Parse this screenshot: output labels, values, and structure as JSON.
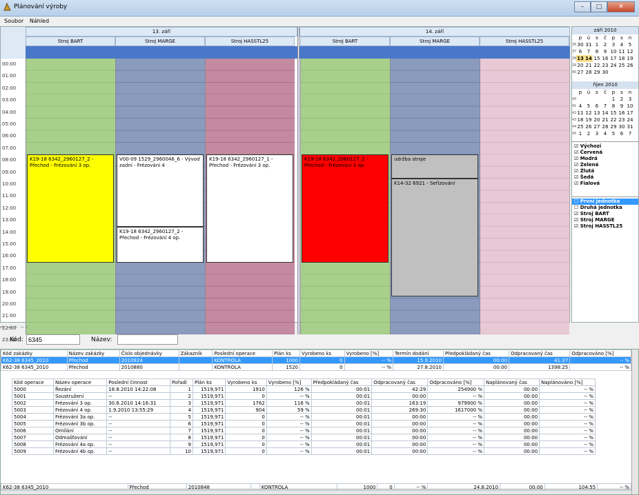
{
  "window": {
    "title": "Plánování výroby",
    "min": "–",
    "max": "□",
    "close": "✕"
  },
  "menu": [
    "Soubor",
    "Náhled"
  ],
  "dates": [
    "13. září",
    "14. září"
  ],
  "resources": [
    "Stroj BART",
    "Stroj MARGE",
    "Stroj HASSTL25",
    "Stroj BART",
    "Stroj MARGE",
    "Stroj HASSTL25"
  ],
  "times": [
    "00:00",
    "01:00",
    "02:00",
    "03:00",
    "04:00",
    "05:00",
    "06:00",
    "07:00",
    "08:00",
    "09:00",
    "10:00",
    "11:00",
    "12:00",
    "13:00",
    "14:00",
    "15:00",
    "16:00",
    "17:00",
    "18:00",
    "19:00",
    "20:00",
    "21:00",
    "22:00",
    "23:00"
  ],
  "appointments": [
    {
      "text": "K19-18 6342_2960127_2 - Přechod - Frézování 3 op.",
      "color": "#ffff00"
    },
    {
      "text": "V00-09 1529_2960046_6 - Vývod zadní - Frézování 4",
      "color": "#ffffff"
    },
    {
      "text": "K19-18 6342_2960127_2 - Přechod - Frézování 4 op.",
      "color": "#ffffff"
    },
    {
      "text": "K19-18 6342_2960127_1 - Přechod - Frézování 3 op.",
      "color": "#ffffff"
    },
    {
      "text": "K19-18 6342_2960127_2 - Přechod - Frézování 3 op.",
      "color": "#ff0000"
    },
    {
      "text": "údržba stroje",
      "color": "#c0c0c0"
    },
    {
      "text": "K14-32 6921 - Seřizování",
      "color": "#c0c0c0"
    }
  ],
  "calendar": {
    "month1": "září 2010",
    "month2": "říjen 2010",
    "dow": [
      "p",
      "ú",
      "s",
      "č",
      "p",
      "s",
      "n"
    ],
    "m1": [
      [
        "36",
        "30",
        "31",
        "1",
        "2",
        "3",
        "4",
        "5"
      ],
      [
        "37",
        "6",
        "7",
        "8",
        "9",
        "10",
        "11",
        "12"
      ],
      [
        "38",
        "13",
        "14",
        "15",
        "16",
        "17",
        "18",
        "19"
      ],
      [
        "39",
        "20",
        "21",
        "22",
        "23",
        "24",
        "25",
        "26"
      ],
      [
        "40",
        "27",
        "28",
        "29",
        "30",
        "",
        "",
        ""
      ]
    ],
    "m2": [
      [
        "40",
        "",
        "",
        "",
        "",
        "1",
        "2",
        "3"
      ],
      [
        "41",
        "4",
        "5",
        "6",
        "7",
        "8",
        "9",
        "10"
      ],
      [
        "42",
        "11",
        "12",
        "13",
        "14",
        "15",
        "16",
        "17"
      ],
      [
        "43",
        "18",
        "19",
        "20",
        "21",
        "22",
        "23",
        "24"
      ],
      [
        "44",
        "25",
        "26",
        "27",
        "28",
        "29",
        "30",
        "31"
      ],
      [
        "45",
        "1",
        "2",
        "3",
        "4",
        "5",
        "6",
        "7"
      ]
    ]
  },
  "filters1": [
    "Výchozí",
    "Červená",
    "Modrá",
    "Zelená",
    "Žlutá",
    "Šedá",
    "Fialová"
  ],
  "filters2": [
    "První jednotka",
    "Druhá jednotka",
    "Stroj BART",
    "Stroj MARGE",
    "Stroj HASSTL25"
  ],
  "filter_row": {
    "code_label": "Kód:",
    "code_value": "6345",
    "name_label": "Název:",
    "name_value": ""
  },
  "toolbar": "⏮ ⏭ + − ‹",
  "orders_headers": [
    "Kód zakázky",
    "Název zakázky",
    "Číslo objednávky",
    "Zákazník",
    "Poslední operace",
    "Plán ks",
    "Vyrobeno ks",
    "Vyrobeno [%]",
    "Termín dodání",
    "Předpokládaný čas",
    "Odpracovaný čas",
    "Odpracováno [%]"
  ],
  "orders": [
    [
      "K62-38 6345_2010",
      "Přechod",
      "2010924",
      "",
      "KONTROLA",
      "1000",
      "0",
      "-- %",
      "15.9.2010",
      "00:00",
      "41:37",
      "-- %"
    ],
    [
      "K62-38 6345_2010",
      "Přechod",
      "2010880",
      "",
      "KONTROLA",
      "1520",
      "0",
      "-- %",
      "27.8.2010",
      "00:00",
      "1398:25",
      "-- %"
    ],
    [
      "K62-38 6345_2010",
      "Přechod",
      "2010848",
      "",
      "KONTROLA",
      "1000",
      "0",
      "-- %",
      "24.8.2010",
      "00:00",
      "104:55",
      "-- %"
    ]
  ],
  "ops_headers": [
    "Kód operace",
    "Název operace",
    "Poslední činnost",
    "Pořadí",
    "Plán ks",
    "Vyrobeno ks",
    "Vyrobeno [%]",
    "Předpokládaný čas",
    "Odpracovaný čas",
    "Odpracováno [%]",
    "Naplánovaný čas",
    "Naplánováno [%]"
  ],
  "ops": [
    [
      "5000",
      "Řezání",
      "18.8.2010 14:22:08",
      "1",
      "1519,971",
      "1910",
      "126 %",
      "00:01",
      "42:29",
      "254900 %",
      "00:00",
      "-- %"
    ],
    [
      "5001",
      "Soustružení",
      "--",
      "2",
      "1519,971",
      "0",
      "-- %",
      "00:01",
      "00:00",
      "-- %",
      "00:00",
      "-- %"
    ],
    [
      "5002",
      "Frézování 3 op.",
      "30.8.2010 14:16:31",
      "3",
      "1519,971",
      "1762",
      "116 %",
      "00:01",
      "163:19",
      "979900 %",
      "00:00",
      "-- %"
    ],
    [
      "5003",
      "Frézování 4 op.",
      "1.9.2010 13:55:29",
      "4",
      "1519,971",
      "904",
      "59 %",
      "00:01",
      "269:30",
      "1617000 %",
      "00:00",
      "-- %"
    ],
    [
      "5004",
      "Frézování 3a op.",
      "--",
      "5",
      "1519,971",
      "0",
      "-- %",
      "00:01",
      "00:00",
      "-- %",
      "00:00",
      "-- %"
    ],
    [
      "5005",
      "Frézování 3b op.",
      "--",
      "6",
      "1519,971",
      "0",
      "-- %",
      "00:01",
      "00:00",
      "-- %",
      "00:00",
      "-- %"
    ],
    [
      "5006",
      "Omílání",
      "--",
      "7",
      "1519,971",
      "0",
      "-- %",
      "00:01",
      "00:00",
      "-- %",
      "00:00",
      "-- %"
    ],
    [
      "5007",
      "Odmašťování",
      "--",
      "8",
      "1519,971",
      "0",
      "-- %",
      "00:01",
      "00:00",
      "-- %",
      "00:00",
      "-- %"
    ],
    [
      "5008",
      "Frézování 4a op.",
      "--",
      "9",
      "1519,971",
      "0",
      "-- %",
      "00:01",
      "00:00",
      "-- %",
      "00:00",
      "-- %"
    ],
    [
      "5009",
      "Frézování 4b op.",
      "--",
      "10",
      "1519,971",
      "0",
      "-- %",
      "00:01",
      "00:00",
      "-- %",
      "00:00",
      "-- %"
    ]
  ]
}
